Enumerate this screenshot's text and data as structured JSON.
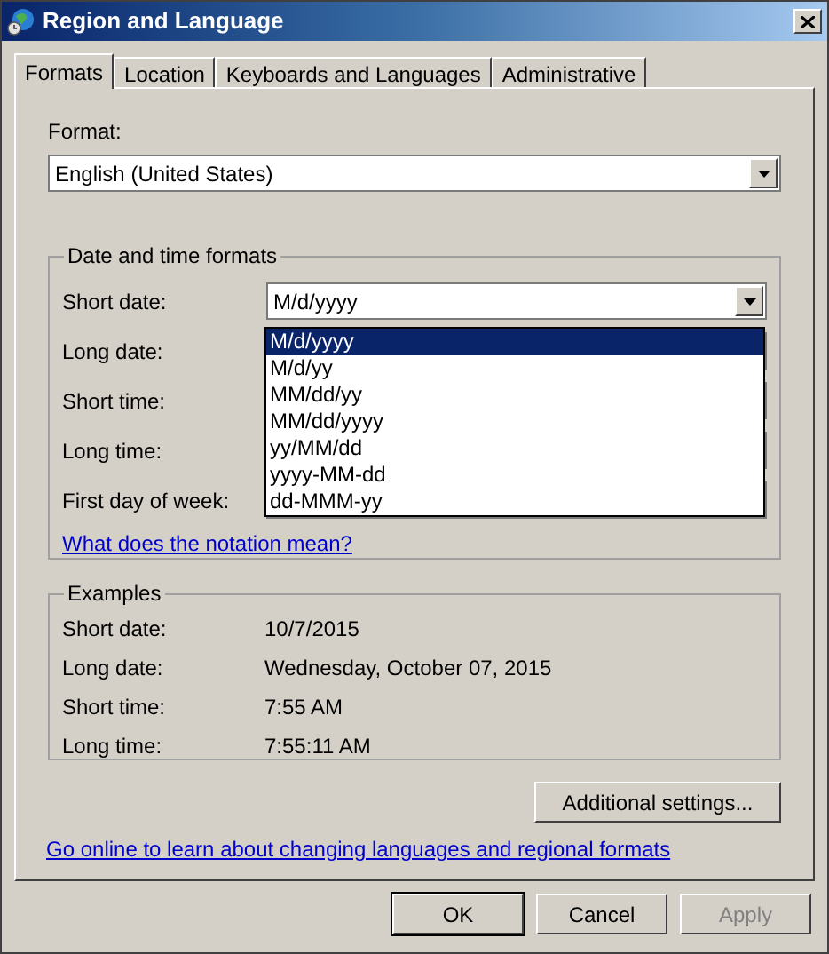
{
  "window": {
    "title": "Region and Language"
  },
  "tabs": [
    {
      "label": "Formats",
      "selected": true
    },
    {
      "label": "Location",
      "selected": false
    },
    {
      "label": "Keyboards and Languages",
      "selected": false
    },
    {
      "label": "Administrative",
      "selected": false
    }
  ],
  "format": {
    "label": "Format:",
    "value": "English (United States)"
  },
  "date_time_formats": {
    "title": "Date and time formats",
    "rows": [
      {
        "label": "Short date:",
        "value": "M/d/yyyy"
      },
      {
        "label": "Long date:"
      },
      {
        "label": "Short time:"
      },
      {
        "label": "Long time:"
      },
      {
        "label": "First day of week:"
      }
    ],
    "dropdown": {
      "options": [
        {
          "label": "M/d/yyyy",
          "selected": true
        },
        {
          "label": "M/d/yy",
          "selected": false
        },
        {
          "label": "MM/dd/yy",
          "selected": false
        },
        {
          "label": "MM/dd/yyyy",
          "selected": false
        },
        {
          "label": "yy/MM/dd",
          "selected": false
        },
        {
          "label": "yyyy-MM-dd",
          "selected": false
        },
        {
          "label": "dd-MMM-yy",
          "selected": false
        }
      ]
    },
    "link": "What does the notation mean?"
  },
  "examples": {
    "title": "Examples",
    "rows": [
      {
        "label": "Short date:",
        "value": "10/7/2015"
      },
      {
        "label": "Long date:",
        "value": "Wednesday, October 07, 2015"
      },
      {
        "label": "Short time:",
        "value": "7:55 AM"
      },
      {
        "label": "Long time:",
        "value": "7:55:11 AM"
      }
    ]
  },
  "additional_settings_button": "Additional settings...",
  "online_link": "Go online to learn about changing languages and regional formats",
  "buttons": [
    {
      "label": "OK",
      "disabled": false,
      "default": true
    },
    {
      "label": "Cancel",
      "disabled": false,
      "default": false
    },
    {
      "label": "Apply",
      "disabled": true,
      "default": false
    }
  ]
}
